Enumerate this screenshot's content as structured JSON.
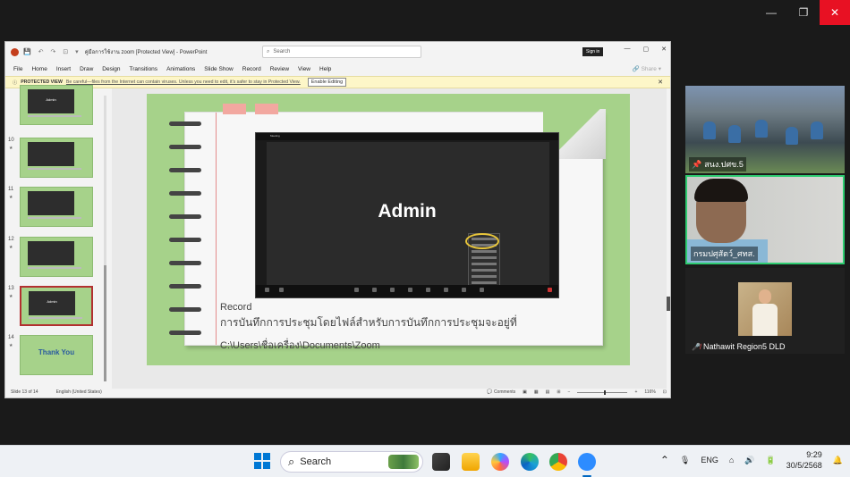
{
  "window_controls": {
    "minimize": "—",
    "restore": "❐",
    "close": "✕"
  },
  "ppt": {
    "title": "คู่มือการใช้งาน zoom [Protected View]  -  PowerPoint",
    "quick_access": "💾 ↶ ↷ ⊡ ▾",
    "search_placeholder": "Search",
    "sign_in": "Sign in",
    "wctl": {
      "min": "—",
      "max": "▢",
      "close": "✕"
    },
    "menu": [
      "File",
      "Home",
      "Insert",
      "Draw",
      "Design",
      "Transitions",
      "Animations",
      "Slide Show",
      "Record",
      "Review",
      "View",
      "Help"
    ],
    "share": "🔗 Share ▾",
    "protected": {
      "label": "PROTECTED VIEW",
      "message": "Be careful—files from the Internet can contain viruses. Unless you need to edit, it's safer to stay in Protected View.",
      "enable": "Enable Editing",
      "close": "✕"
    },
    "thumbnails": [
      {
        "num": "",
        "label": "Admin"
      },
      {
        "num": "10",
        "label": ""
      },
      {
        "num": "11",
        "label": ""
      },
      {
        "num": "12",
        "label": ""
      },
      {
        "num": "13",
        "label": "Admin",
        "selected": true
      },
      {
        "num": "14",
        "label": "Thank You"
      }
    ],
    "slide": {
      "shot_title": "Meeting",
      "admin": "Admin",
      "heading": "Record",
      "body": "การบันทึกการประชุมโดยไฟล์สำหรับการบันทึกการประชุมจะอยู่ที่",
      "path": "C:\\Users\\ชื่อเครื่อง\\Documents\\Zoom"
    },
    "status": {
      "slide": "Slide 13 of 14",
      "language": "English (United States)",
      "comments": "💬 Comments",
      "zoom": "116%"
    }
  },
  "participants": [
    {
      "name": "สนง.ปศข.5",
      "icon": "pin"
    },
    {
      "name": "กรมปศุสัตว์_ศทส.",
      "icon": "none"
    },
    {
      "name": "Nathawit Region5 DLD",
      "icon": "mic-muted"
    }
  ],
  "taskbar": {
    "search": "Search",
    "lang": "ENG",
    "time": "9:29",
    "date": "30/5/2568"
  },
  "colors": {
    "accent": "#0067c0",
    "slide_bg": "#a6d28a",
    "speaker": "#2ecc71",
    "close": "#e81123"
  }
}
